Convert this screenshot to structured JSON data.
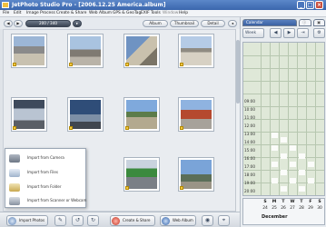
{
  "window": {
    "title": "JetPhoto Studio Pro - [2006.12.25 America.album]"
  },
  "menu": [
    "File",
    "Edit",
    "Image Process",
    "Create & Share",
    "Web Album",
    "GPS & GeoTag",
    "EXIF Tools",
    "Window",
    "Help"
  ],
  "toolbar": {
    "counter": "200 / 340",
    "view_album": "Album",
    "view_thumbnail": "Thumbnail",
    "view_detail": "Detail"
  },
  "import_menu": [
    {
      "label": "Import from Camera",
      "icon": "camera-icon"
    },
    {
      "label": "Import from Files",
      "icon": "files-icon"
    },
    {
      "label": "Import from Folder",
      "icon": "folder-icon"
    },
    {
      "label": "Import from Scanner or Webcam",
      "icon": "scanner-icon"
    }
  ],
  "bottom": {
    "import": "Import Photos",
    "create_share": "Create & Share",
    "web_album": "Web Album"
  },
  "calendar": {
    "tab_active": "Calendar",
    "view": "Week",
    "times": [
      "09:00",
      "10:00",
      "11:00",
      "12:00",
      "13:00",
      "14:00",
      "15:00",
      "16:00",
      "17:00",
      "18:00",
      "19:00",
      "20:00"
    ],
    "days": [
      "S",
      "M",
      "T",
      "W",
      "T",
      "F",
      "S"
    ],
    "dates": [
      "24",
      "25",
      "26",
      "27",
      "28",
      "29",
      "30"
    ],
    "month": "December"
  },
  "colors": {
    "accent": "#3b62a3",
    "tag": "#f3c845"
  }
}
